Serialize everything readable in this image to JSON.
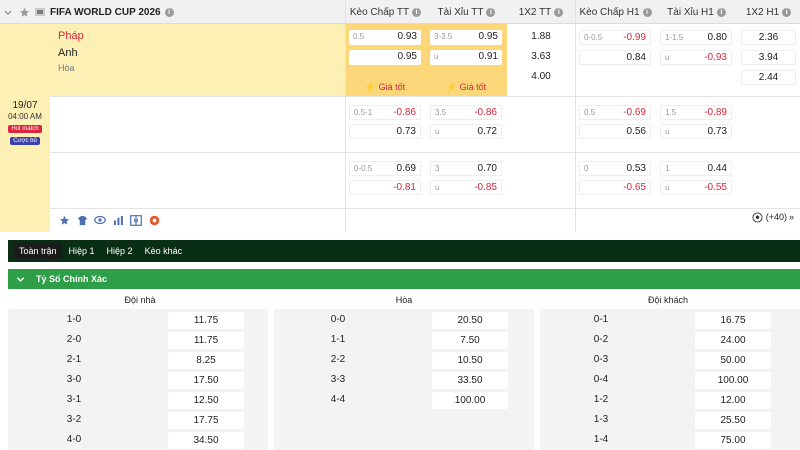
{
  "header": {
    "league": "FIFA WORLD CUP 2026",
    "columns": [
      "Kèo Chấp TT",
      "Tài Xỉu TT",
      "1X2 TT",
      "Kèo Chấp H1",
      "Tài Xỉu H1",
      "1X2 H1"
    ]
  },
  "match": {
    "home": "Pháp",
    "away": "Anh",
    "draw": "Hòa",
    "date": "19/07",
    "time": "04:00 AM",
    "badges": [
      "Hot match",
      "Cược bủ"
    ],
    "good_odds_label": "Giá tốt",
    "more_bets": "(+40)"
  },
  "rows": [
    {
      "ah_tt": {
        "h1": "0.5",
        "v1": "0.93",
        "h2": "",
        "v2": "0.95"
      },
      "ou_tt": {
        "h1": "3-3.5",
        "v1": "0.95",
        "h2": "u",
        "v2": "0.91"
      },
      "x12_tt": [
        "1.88",
        "3.63",
        "4.00"
      ],
      "ah_h1": {
        "h1": "0-0.5",
        "v1": "-0.99",
        "h2": "",
        "v2": "0.84"
      },
      "ou_h1": {
        "h1": "1-1.5",
        "v1": "0.80",
        "h2": "u",
        "v2": "-0.93"
      },
      "x12_h1": [
        "2.36",
        "3.94",
        "2.44"
      ]
    },
    {
      "ah_tt": {
        "h1": "0.5-1",
        "v1": "-0.86",
        "h2": "",
        "v2": "0.73"
      },
      "ou_tt": {
        "h1": "3.5",
        "v1": "-0.86",
        "h2": "u",
        "v2": "0.72"
      },
      "ah_h1": {
        "h1": "0.5",
        "v1": "-0.69",
        "h2": "",
        "v2": "0.56"
      },
      "ou_h1": {
        "h1": "1.5",
        "v1": "-0.89",
        "h2": "u",
        "v2": "0.73"
      }
    },
    {
      "ah_tt": {
        "h1": "0-0.5",
        "v1": "0.69",
        "h2": "",
        "v2": "-0.81"
      },
      "ou_tt": {
        "h1": "3",
        "v1": "0.70",
        "h2": "u",
        "v2": "-0.85"
      },
      "ah_h1": {
        "h1": "0",
        "v1": "0.53",
        "h2": "",
        "v2": "-0.65"
      },
      "ou_h1": {
        "h1": "1",
        "v1": "0.44",
        "h2": "u",
        "v2": "-0.55"
      }
    }
  ],
  "tabs": [
    "Toàn trận",
    "Hiệp 1",
    "Hiệp 2",
    "Kèo khác"
  ],
  "section_title": "Tỷ Số Chính Xác",
  "cs_columns": {
    "home": "Đội nhà",
    "draw": "Hòa",
    "away": "Đội khách"
  },
  "correct_score": {
    "home": [
      [
        "1-0",
        "11.75"
      ],
      [
        "2-0",
        "11.75"
      ],
      [
        "2-1",
        "8.25"
      ],
      [
        "3-0",
        "17.50"
      ],
      [
        "3-1",
        "12.50"
      ],
      [
        "3-2",
        "17.75"
      ],
      [
        "4-0",
        "34.50"
      ]
    ],
    "draw": [
      [
        "0-0",
        "20.50"
      ],
      [
        "1-1",
        "7.50"
      ],
      [
        "2-2",
        "10.50"
      ],
      [
        "3-3",
        "33.50"
      ],
      [
        "4-4",
        "100.00"
      ]
    ],
    "away": [
      [
        "0-1",
        "16.75"
      ],
      [
        "0-2",
        "24.00"
      ],
      [
        "0-3",
        "50.00"
      ],
      [
        "0-4",
        "100.00"
      ],
      [
        "1-2",
        "12.00"
      ],
      [
        "1-3",
        "25.50"
      ],
      [
        "1-4",
        "75.00"
      ]
    ]
  },
  "colors": {
    "highlight": "#fdf0b5",
    "main_odds": "#fbd77a",
    "negative": "#d7263d",
    "tab_bar": "#0a2d16",
    "section": "#2e9e48"
  }
}
